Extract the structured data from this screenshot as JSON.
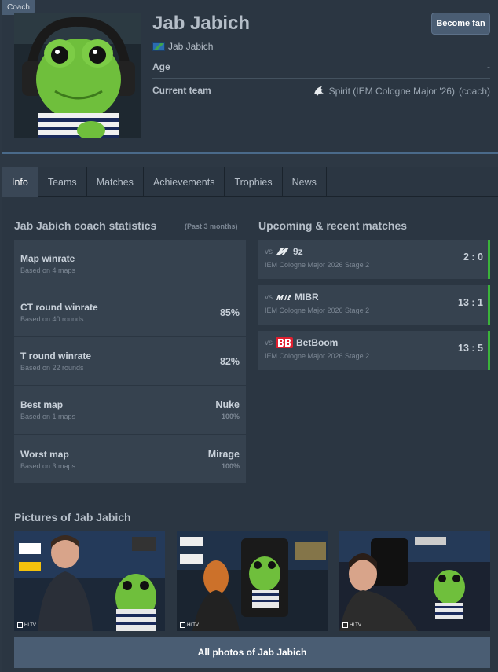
{
  "profile": {
    "role_tag": "Coach",
    "name": "Jab Jabich",
    "nickname": "Jab Jabich",
    "age_label": "Age",
    "age_value": "-",
    "team_label": "Current team",
    "team_value": "Spirit (IEM Cologne Major '26)",
    "team_role": "(coach)",
    "fan_button": "Become fan"
  },
  "tabs": [
    "Info",
    "Teams",
    "Matches",
    "Achievements",
    "Trophies",
    "News"
  ],
  "stats": {
    "title": "Jab Jabich coach statistics",
    "period": "(Past 3 months)",
    "items": [
      {
        "name": "Map winrate",
        "sub": "Based on 4 maps",
        "value": "",
        "pct": ""
      },
      {
        "name": "CT round winrate",
        "sub": "Based on 40 rounds",
        "value": "85%",
        "pct": ""
      },
      {
        "name": "T round winrate",
        "sub": "Based on 22 rounds",
        "value": "82%",
        "pct": ""
      },
      {
        "name": "Best map",
        "sub": "Based on 1 maps",
        "value": "Nuke",
        "pct": "100%"
      },
      {
        "name": "Worst map",
        "sub": "Based on 3 maps",
        "value": "Mirage",
        "pct": "100%"
      }
    ]
  },
  "matches": {
    "title": "Upcoming & recent matches",
    "items": [
      {
        "vs": "vs",
        "opponent": "9z",
        "event": "IEM Cologne Major 2026 Stage 2",
        "score": "2 : 0"
      },
      {
        "vs": "vs",
        "opponent": "MIBR",
        "event": "IEM Cologne Major 2026 Stage 2",
        "score": "13 : 1"
      },
      {
        "vs": "vs",
        "opponent": "BetBoom",
        "event": "IEM Cologne Major 2026 Stage 2",
        "score": "13 : 5"
      }
    ]
  },
  "pictures": {
    "title": "Pictures of Jab Jabich",
    "watermark": "HLTV",
    "all_button": "All photos of Jab Jabich"
  },
  "colors": {
    "accent": "#4a5d73",
    "win": "#3bb33b",
    "background": "#2d3844"
  },
  "icons": [
    "flag-icon",
    "spirit-logo-icon",
    "9z-logo-icon",
    "mibr-logo-icon",
    "betboom-logo-icon",
    "hltv-logo-icon"
  ]
}
